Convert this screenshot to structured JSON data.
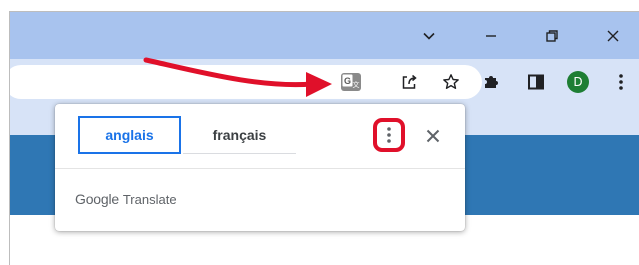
{
  "translate_popup": {
    "source_language_tab": "anglais",
    "target_language_tab": "français",
    "footer_brand": "Google",
    "footer_product": "Translate"
  },
  "profile": {
    "avatar_letter": "D"
  },
  "colors": {
    "titlebar": "#a8c3ee",
    "toolbar": "#d7e3f7",
    "page_header": "#2f77b4",
    "accent": "#1a73e8",
    "annotation_red": "#e0102a",
    "avatar_bg": "#1e7e34"
  },
  "icons": {
    "titlebar": [
      "chevron-down-icon",
      "minimize-icon",
      "restore-icon",
      "close-icon"
    ],
    "toolbar": [
      "translate-icon",
      "share-icon",
      "star-icon",
      "extensions-icon",
      "side-panel-icon",
      "avatar",
      "more-vert-icon"
    ],
    "popup": [
      "more-vert-icon",
      "close-icon"
    ]
  },
  "annotations": {
    "arrow": "red arrow pointing to translate icon",
    "highlight": "red rounded box around popup options menu"
  }
}
